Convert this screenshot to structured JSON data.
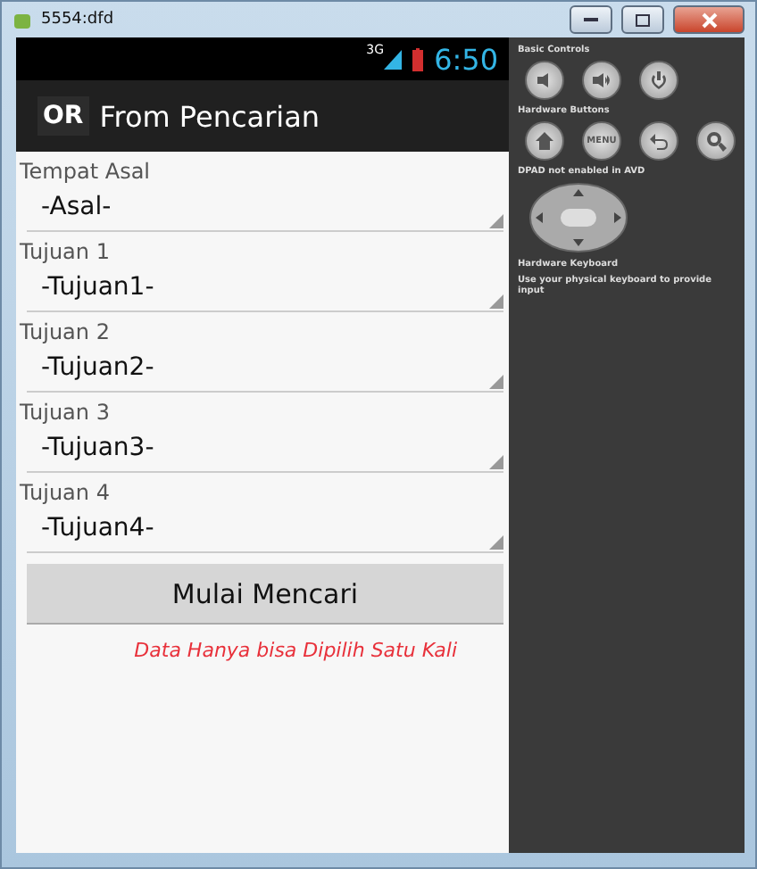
{
  "window": {
    "title": "5554:dfd"
  },
  "status_bar": {
    "network": "3G",
    "time": "6:50"
  },
  "action_bar": {
    "logo": "OR",
    "title": "From Pencarian"
  },
  "form": {
    "fields": [
      {
        "label": "Tempat Asal",
        "value": "-Asal-"
      },
      {
        "label": "Tujuan 1",
        "value": "-Tujuan1-"
      },
      {
        "label": "Tujuan 2",
        "value": "-Tujuan2-"
      },
      {
        "label": "Tujuan 3",
        "value": "-Tujuan3-"
      },
      {
        "label": "Tujuan 4",
        "value": "-Tujuan4-"
      }
    ],
    "button": "Mulai Mencari",
    "note": "Data Hanya bisa Dipilih Satu Kali"
  },
  "controls": {
    "basic_title": "Basic Controls",
    "hardware_title": "Hardware Buttons",
    "menu_label": "MENU",
    "dpad_note": "DPAD not enabled in AVD",
    "keyboard_title": "Hardware Keyboard",
    "keyboard_note": "Use your physical keyboard to provide input"
  }
}
